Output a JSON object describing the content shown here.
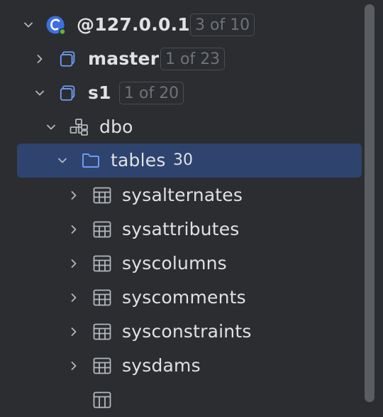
{
  "tree": {
    "connection": {
      "label": "@127.0.0.1",
      "badge": "3 of 10"
    },
    "db_master": {
      "label": "master",
      "badge": "1 of 23"
    },
    "db_s1": {
      "label": "s1",
      "badge": "1 of 20"
    },
    "schema_dbo": {
      "label": "dbo"
    },
    "folder_tables": {
      "label": "tables",
      "count": "30"
    },
    "tables": [
      {
        "label": "sysalternates"
      },
      {
        "label": "sysattributes"
      },
      {
        "label": "syscolumns"
      },
      {
        "label": "syscomments"
      },
      {
        "label": "sysconstraints"
      },
      {
        "label": "sysdams"
      }
    ]
  },
  "colors": {
    "background": "#2b2d30",
    "selection": "#2e436e",
    "accent_blue": "#6e9cf7",
    "connection_green": "#5fb832",
    "text": "#dfe1e5",
    "badge_text": "#6f737a"
  }
}
